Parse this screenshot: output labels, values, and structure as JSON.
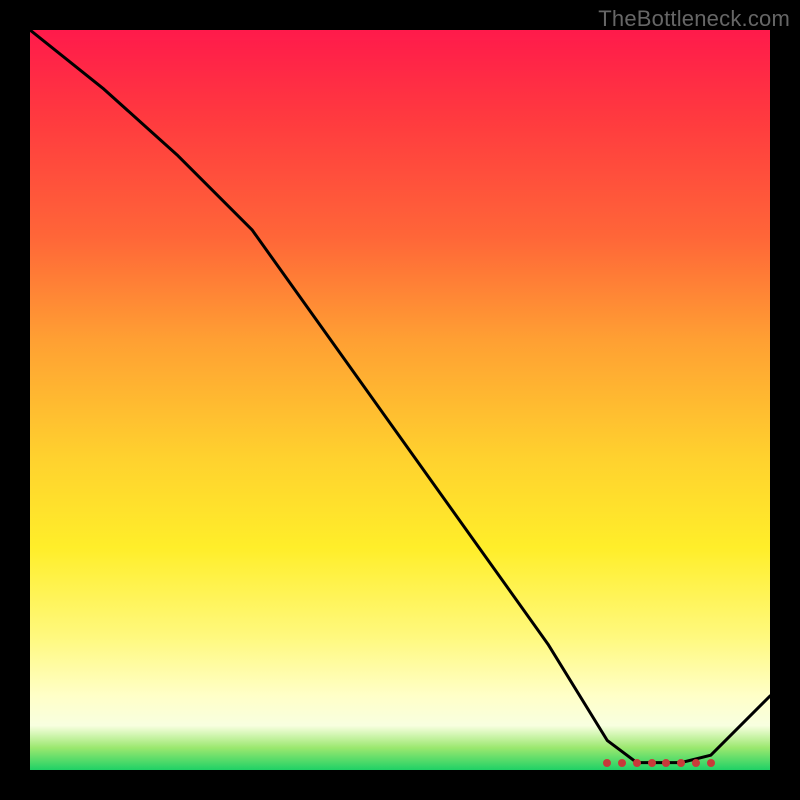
{
  "watermark": "TheBottleneck.com",
  "colors": {
    "frame": "#000000",
    "watermark": "#666666",
    "curve": "#000000",
    "dot": "#c83a3a"
  },
  "chart_data": {
    "type": "line",
    "title": "",
    "xlabel": "",
    "ylabel": "",
    "xlim": [
      0,
      100
    ],
    "ylim": [
      0,
      100
    ],
    "legend": "none",
    "grid": false,
    "series": [
      {
        "name": "bottleneck-curve",
        "x": [
          0,
          10,
          20,
          30,
          40,
          50,
          60,
          70,
          78,
          82,
          88,
          92,
          100
        ],
        "y": [
          100,
          92,
          83,
          73,
          59,
          45,
          31,
          17,
          4,
          1,
          1,
          2,
          10
        ]
      }
    ],
    "markers": {
      "name": "optimal-range-dots",
      "x": [
        78,
        80,
        82,
        84,
        86,
        88,
        90,
        92
      ],
      "y_approx": 1
    },
    "background_gradient_stops": [
      {
        "pos": 0,
        "color": "#ff1a4b"
      },
      {
        "pos": 12,
        "color": "#ff3a3f"
      },
      {
        "pos": 28,
        "color": "#ff6638"
      },
      {
        "pos": 42,
        "color": "#ffa033"
      },
      {
        "pos": 58,
        "color": "#ffd22e"
      },
      {
        "pos": 70,
        "color": "#ffee2a"
      },
      {
        "pos": 82,
        "color": "#fff97e"
      },
      {
        "pos": 90,
        "color": "#ffffc8"
      },
      {
        "pos": 94,
        "color": "#f8ffe0"
      },
      {
        "pos": 97,
        "color": "#9be86f"
      },
      {
        "pos": 100,
        "color": "#1fd166"
      }
    ]
  }
}
